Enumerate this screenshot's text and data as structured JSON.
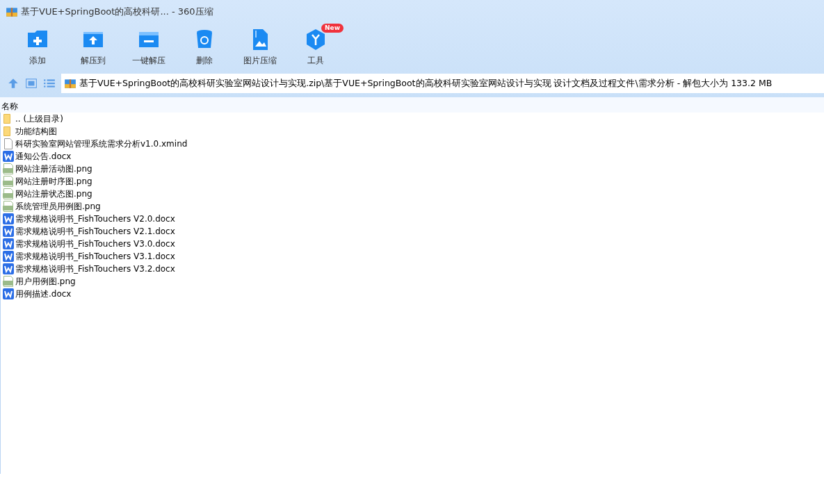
{
  "window": {
    "title": "基于VUE+SpringBoot的高校科研... - 360压缩"
  },
  "toolbar": [
    {
      "label": "添加",
      "kind": "add"
    },
    {
      "label": "解压到",
      "kind": "extract"
    },
    {
      "label": "一键解压",
      "kind": "oneclick"
    },
    {
      "label": "删除",
      "kind": "delete"
    },
    {
      "label": "图片压缩",
      "kind": "image"
    },
    {
      "label": "工具",
      "kind": "tools",
      "badge": "New"
    }
  ],
  "address_bar": {
    "path": "基于VUE+SpringBoot的高校科研实验室网站设计与实现.zip\\基于VUE+SpringBoot的高校科研实验室网站设计与实现 设计文档及过程文件\\需求分析 - 解包大小为 133.2 MB"
  },
  "table": {
    "columns": [
      "名称"
    ],
    "rows": [
      {
        "name": ".. (上级目录)",
        "kind": "folder"
      },
      {
        "name": "功能结构图",
        "kind": "folder"
      },
      {
        "name": "科研实验室网站管理系统需求分析v1.0.xmind",
        "kind": "file"
      },
      {
        "name": "通知公告.docx",
        "kind": "doc"
      },
      {
        "name": "网站注册活动图.png",
        "kind": "png"
      },
      {
        "name": "网站注册时序图.png",
        "kind": "png"
      },
      {
        "name": "网站注册状态图.png",
        "kind": "png"
      },
      {
        "name": "系统管理员用例图.png",
        "kind": "png"
      },
      {
        "name": "需求规格说明书_FishTouchers V2.0.docx",
        "kind": "doc"
      },
      {
        "name": "需求规格说明书_FishTouchers V2.1.docx",
        "kind": "doc"
      },
      {
        "name": "需求规格说明书_FishTouchers V3.0.docx",
        "kind": "doc"
      },
      {
        "name": "需求规格说明书_FishTouchers V3.1.docx",
        "kind": "doc"
      },
      {
        "name": "需求规格说明书_FishTouchers V3.2.docx",
        "kind": "doc"
      },
      {
        "name": "用户用例图.png",
        "kind": "png"
      },
      {
        "name": "用例描述.docx",
        "kind": "doc"
      }
    ]
  }
}
